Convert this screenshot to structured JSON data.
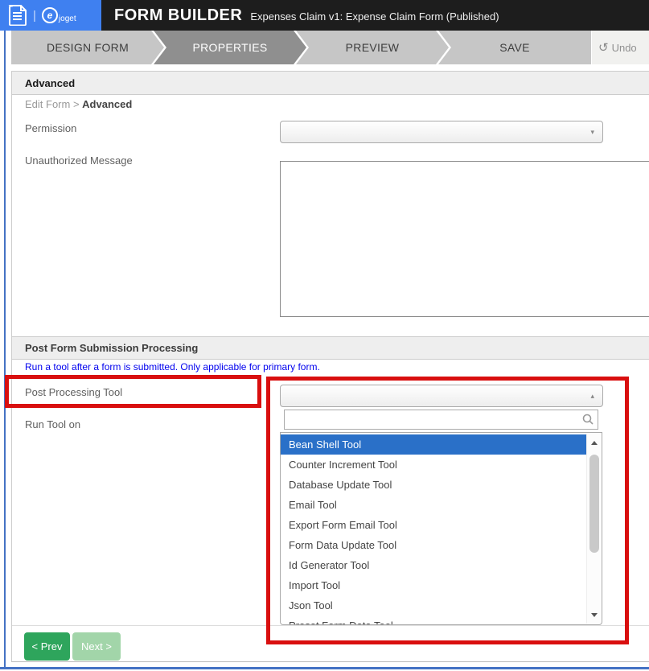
{
  "header": {
    "app_title": "FORM BUILDER",
    "subtitle": "Expenses Claim v1: Expense Claim Form (Published)",
    "logo_letter": "e",
    "logo_word": "joget",
    "divider": "|"
  },
  "nav": {
    "tabs": [
      {
        "label": "DESIGN FORM",
        "active": false
      },
      {
        "label": "PROPERTIES",
        "active": true
      },
      {
        "label": "PREVIEW",
        "active": false
      },
      {
        "label": "SAVE",
        "active": false
      }
    ],
    "undo_icon": "↺",
    "undo_label": "Undo"
  },
  "page": {
    "section1_title": "Advanced",
    "breadcrumb": {
      "parent": "Edit Form",
      "separator": " > ",
      "current": "Advanced"
    },
    "permission_label": "Permission",
    "permission_value": "",
    "unauthorized_label": "Unauthorized Message",
    "unauthorized_value": "",
    "section2_title": "Post Form Submission Processing",
    "hint": "Run a tool after a form is submitted. Only applicable for primary form.",
    "post_tool_label": "Post Processing Tool",
    "run_tool_label": "Run Tool on",
    "select_arrow_down": "▾",
    "select_arrow_up": "▴"
  },
  "dropdown": {
    "selected_value": "",
    "search_value": "",
    "selected_index": 0,
    "options": [
      "Bean Shell Tool",
      "Counter Increment Tool",
      "Database Update Tool",
      "Email Tool",
      "Export Form Email Tool",
      "Form Data Update Tool",
      "Id Generator Tool",
      "Import Tool",
      "Json Tool",
      "Preset Form Data Tool"
    ]
  },
  "buttons": {
    "prev": "< Prev",
    "next": "Next >"
  },
  "colors": {
    "logo_blue": "#3f80f0",
    "header_black": "#1d1d1d",
    "active_tab_gray": "#8f8f8f",
    "highlight_blue": "#2a70c8",
    "hint_blue": "#0000ee",
    "annotation_red": "#d90f0f",
    "prev_green": "#2ea55c",
    "next_green_disabled": "#a2d5a9",
    "frame_blue": "#4472c4"
  }
}
